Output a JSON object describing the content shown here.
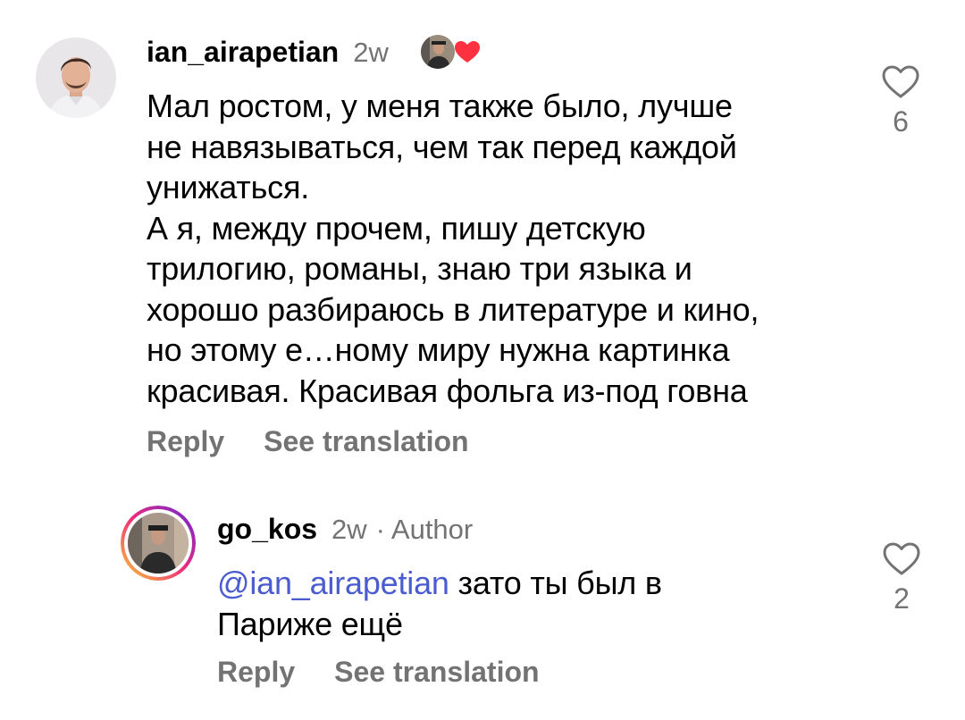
{
  "comments": [
    {
      "username": "ian_airapetian",
      "time": "2w",
      "body": "Мал ростом, у меня также было, лучше\nне навязываться, чем так перед каждой\nунижаться.\nА я, между прочем, пишу детскую\nтрилогию, романы, знаю три языка и\nхорошо разбираюсь в литературе и кино,\nно этому е…ному миру нужна картинка\nкрасивая. Красивая фольга из-под говна",
      "reply_label": "Reply",
      "translate_label": "See translation",
      "like_count": "6",
      "avatar_icon": "user-portrait-avatar",
      "liked_by_author": true
    },
    {
      "username": "go_kos",
      "time": "2w",
      "author_tag": "· Author",
      "mention": "@ian_airapetian",
      "body": " зато ты был в\nПариже ещё",
      "reply_label": "Reply",
      "translate_label": "See translation",
      "like_count": "2",
      "avatar_icon": "user-portrait-avatar"
    }
  ],
  "colors": {
    "secondary_text": "#737373",
    "mention": "#4a5ccf",
    "heart_red": "#ff3040",
    "story_ring_start": "#f9ce34",
    "story_ring_mid": "#ee2a7b",
    "story_ring_end": "#6228d7"
  }
}
